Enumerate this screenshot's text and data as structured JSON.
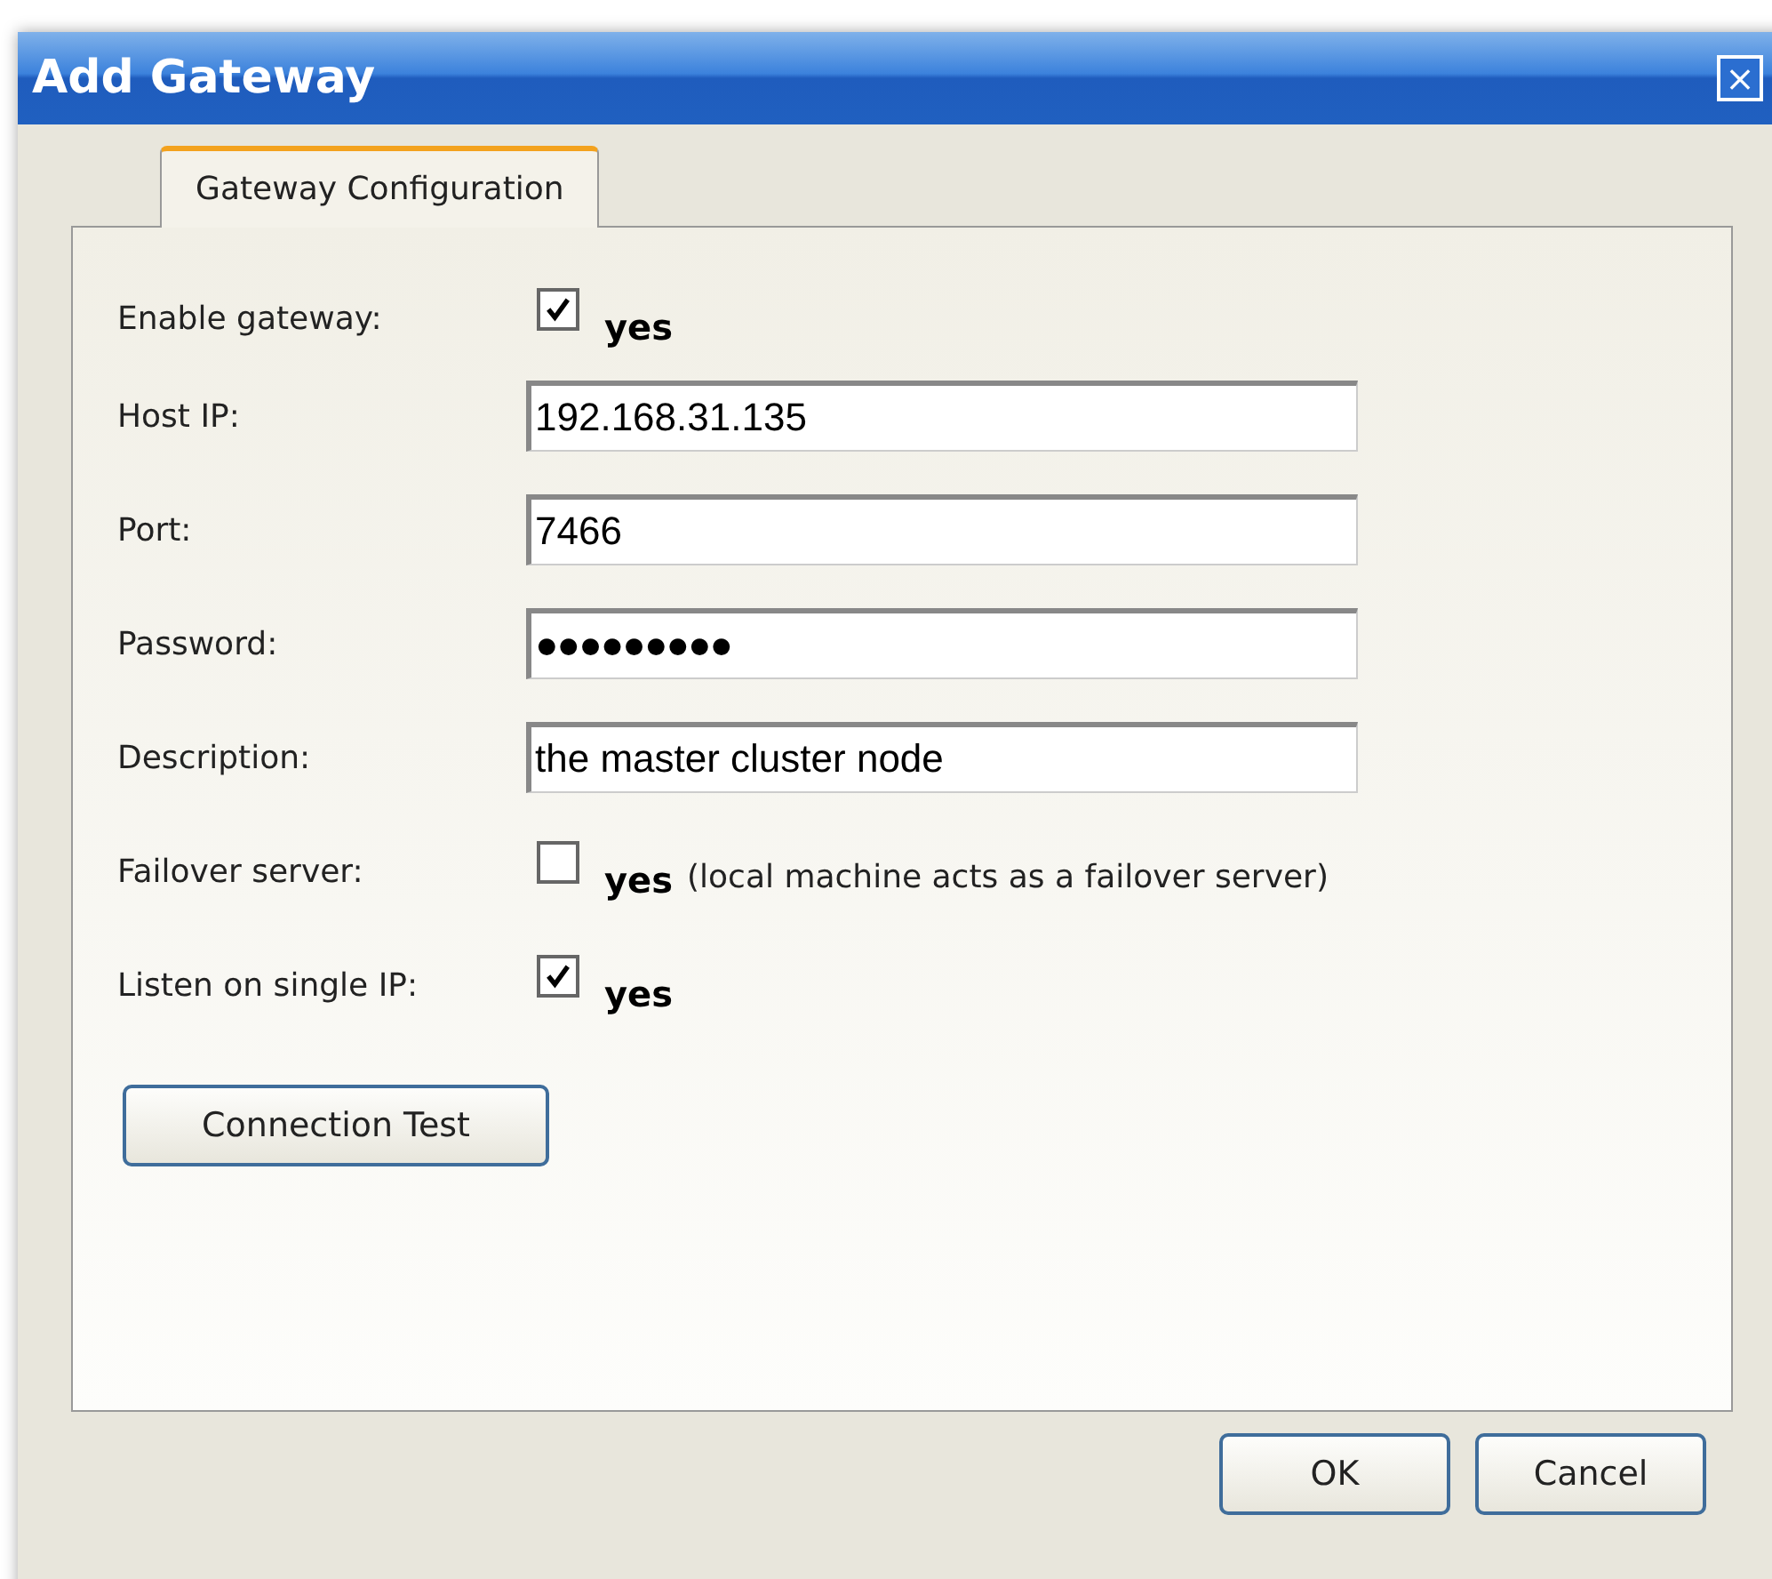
{
  "window": {
    "title": "Add Gateway",
    "close": "×"
  },
  "tabs": [
    {
      "label": "Gateway Configuration",
      "selected": true
    }
  ],
  "fields": [
    {
      "kind": "checkbox",
      "label": "Enable gateway:",
      "checked": true,
      "option": "yes"
    },
    {
      "kind": "text",
      "label": "Host IP:",
      "value": "192.168.31.135"
    },
    {
      "kind": "text",
      "label": "Port:",
      "value": "7466"
    },
    {
      "kind": "password",
      "label": "Password:",
      "value": "●●●●●●●●●"
    },
    {
      "kind": "text",
      "label": "Description:",
      "value": "the master cluster node"
    },
    {
      "kind": "checkbox",
      "label": "Failover server:",
      "checked": false,
      "option": "yes",
      "note": "(local machine acts as a failover server)"
    },
    {
      "kind": "checkbox",
      "label": "Listen on single IP:",
      "checked": true,
      "option": "yes"
    }
  ],
  "test_button": "Connection Test",
  "buttons": [
    "OK",
    "Cancel"
  ]
}
